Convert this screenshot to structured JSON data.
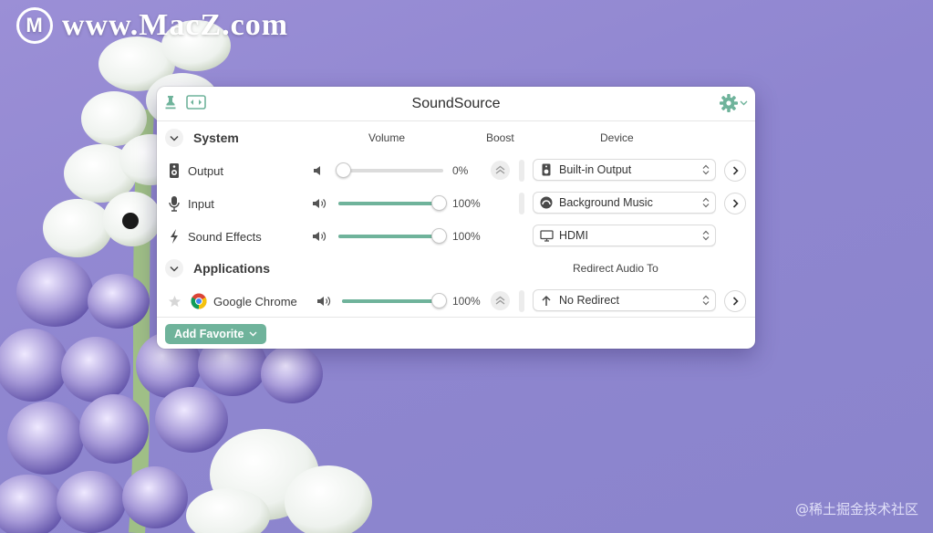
{
  "wallpaper": {
    "watermark_logo": "M",
    "watermark_text": "www.MacZ.com",
    "credit": "@稀土掘金技术社区"
  },
  "window": {
    "title": "SoundSource",
    "icons": {
      "pin": "pin-icon",
      "expand": "expand-window-icon",
      "settings": "gear-icon"
    }
  },
  "system": {
    "title": "System",
    "col_volume": "Volume",
    "col_boost": "Boost",
    "col_device": "Device",
    "rows": [
      {
        "label": "Output",
        "icon": "speaker-device-icon",
        "volume": 0,
        "volume_text": "0%",
        "device": "Built-in Output",
        "device_icon": "speaker-device-icon"
      },
      {
        "label": "Input",
        "icon": "microphone-icon",
        "volume": 100,
        "volume_text": "100%",
        "device": "Background Music",
        "device_icon": "background-music-icon"
      },
      {
        "label": "Sound Effects",
        "icon": "lightning-icon",
        "volume": 100,
        "volume_text": "100%",
        "device": "HDMI",
        "device_icon": "monitor-icon"
      }
    ]
  },
  "applications": {
    "title": "Applications",
    "col_redirect": "Redirect Audio To",
    "rows": [
      {
        "label": "Google Chrome",
        "icon": "chrome-icon",
        "volume": 100,
        "volume_text": "100%",
        "redirect": "No Redirect",
        "redirect_icon": "arrow-up-icon"
      }
    ]
  },
  "footer": {
    "add_favorite": "Add Favorite"
  },
  "colors": {
    "accent": "#6fb39b",
    "background": "#9b8fd6",
    "window": "#ffffff"
  }
}
